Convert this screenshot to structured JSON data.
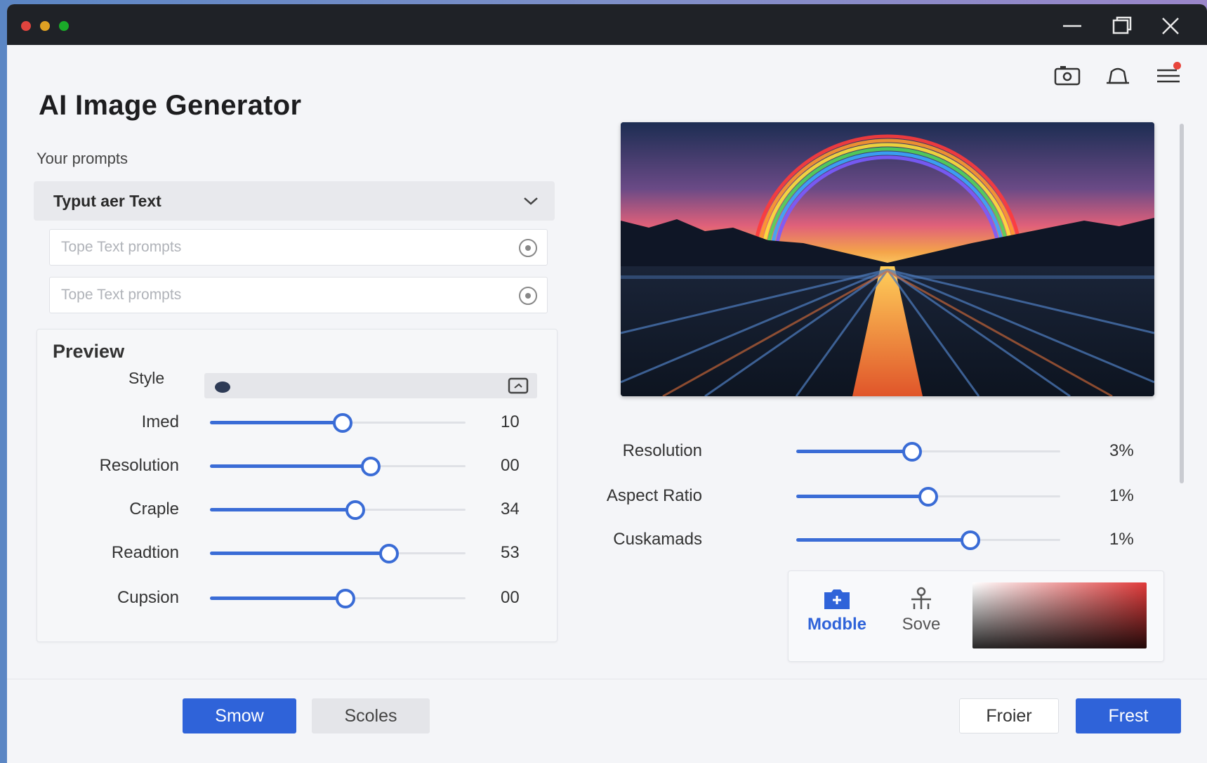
{
  "window": {
    "dots": [
      "#e0443e",
      "#dea123",
      "#1aab29"
    ]
  },
  "header": {
    "title": "AI Image Generator",
    "icons": [
      "camera-icon",
      "bell-icon",
      "menu-icon"
    ]
  },
  "prompts": {
    "label": "Your prompts",
    "dropdown_value": "Typut aer Text",
    "inputs": [
      {
        "placeholder": "Tope Text prompts",
        "value": ""
      },
      {
        "placeholder": "Tope Text prompts",
        "value": ""
      }
    ]
  },
  "preview": {
    "title": "Preview",
    "style_label": "Style",
    "sliders": [
      {
        "label": "Imed",
        "value": "10",
        "level": 0.52
      },
      {
        "label": "Resolution",
        "value": "00",
        "level": 0.63
      },
      {
        "label": "Craple",
        "value": "34",
        "level": 0.57
      },
      {
        "label": "Readtion",
        "value": "53",
        "level": 0.7
      },
      {
        "label": "Cupsion",
        "value": "00",
        "level": 0.53
      }
    ]
  },
  "output": {
    "sliders": [
      {
        "label": "Resolution",
        "value": "3%",
        "level": 0.44
      },
      {
        "label": "Aspect Ratio",
        "value": "1%",
        "level": 0.5
      },
      {
        "label": "Cuskamads",
        "value": "1%",
        "level": 0.66
      }
    ],
    "tools": {
      "modble_label": "Modble",
      "sove_label": "Sove"
    }
  },
  "footer": {
    "smow_label": "Smow",
    "scoles_label": "Scoles",
    "froier_label": "Froier",
    "frest_label": "Frest"
  },
  "colors": {
    "accent": "#2f63d9",
    "slider_fill": "#3a6cd6",
    "notification": "#e8453c"
  }
}
